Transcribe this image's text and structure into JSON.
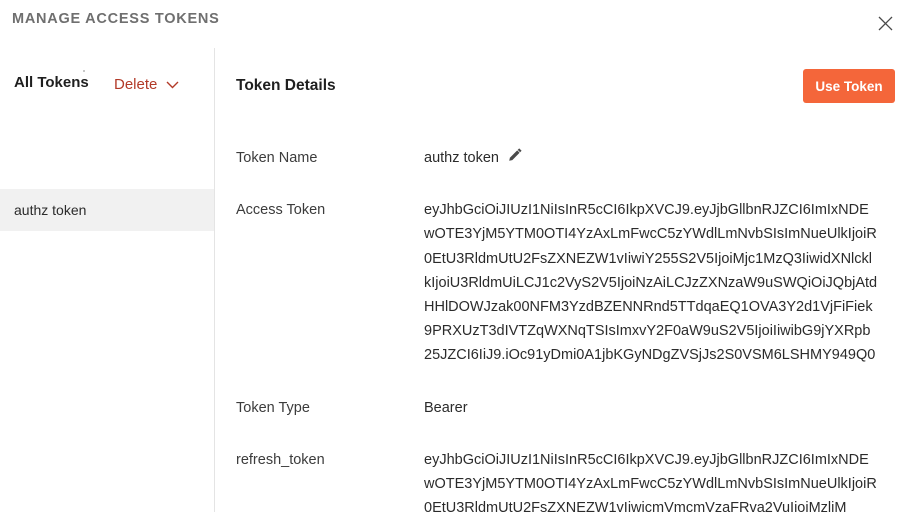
{
  "header": {
    "title": "MANAGE ACCESS TOKENS",
    "close_icon": "close-icon"
  },
  "sidebar": {
    "all_tokens_label": "All Tokens",
    "delete_label": "Delete",
    "delete_chevron_icon": "chevron-down-icon",
    "items": [
      {
        "label": "authz token",
        "selected": true
      }
    ]
  },
  "details": {
    "title": "Token Details",
    "use_token_label": "Use Token",
    "edit_icon": "pencil-icon",
    "rows": {
      "token_name": {
        "label": "Token Name",
        "value": "authz token"
      },
      "access_token": {
        "label": "Access Token",
        "value": "eyJhbGciOiJIUzI1NiIsInR5cCI6IkpXVCJ9.eyJjbGllbnRJZCI6ImIxNDEwOTE3YjM5YTM0OTI4YzAxLmFwcC5zYWdlLmNvbSIsImNueUlkIjoiR0EtU3RldmUtU2FsZXNEZW1vIiwiY255S2V5IjoiMjc1MzQ3IiwidXNlcklkIjoiU3RldmUiLCJ1c2VyS2V5IjoiNzAiLCJzZXNzaW9uSWQiOiJQbjAtdHHlDOWJzak00NFM3YzdBZENNRnd5TTdqaEQ1OVA3Y2d1VjFiFiek9PRXUzT3dIVTZqWXNqTSIsImxvY2F0aW9uS2V5IjoiIiwibG9jYXRpb25JZCI6IiJ9.iOc91yDmi0A1jbKGyNDgZVSjJs2S0VSM6LSHMY949Q0"
      },
      "token_type": {
        "label": "Token Type",
        "value": "Bearer"
      },
      "refresh_token": {
        "label": "refresh_token",
        "value": "eyJhbGciOiJIUzI1NiIsInR5cCI6IkpXVCJ9.eyJjbGllbnRJZCI6ImIxNDEwOTE3YjM5YTM0OTI4YzAxLmFwcC5zYWdlLmNvbSIsImNueUlkIjoiR0EtU3RldmUtU2FsZXNEZW1vIiwicmVmcmVzaFRva2VuIjoiMzliM"
      }
    }
  },
  "colors": {
    "accent": "#f4663a",
    "delete_text": "#b23a28",
    "title_text": "#6f6f6f",
    "selected_row_bg": "#f1f1f1"
  }
}
